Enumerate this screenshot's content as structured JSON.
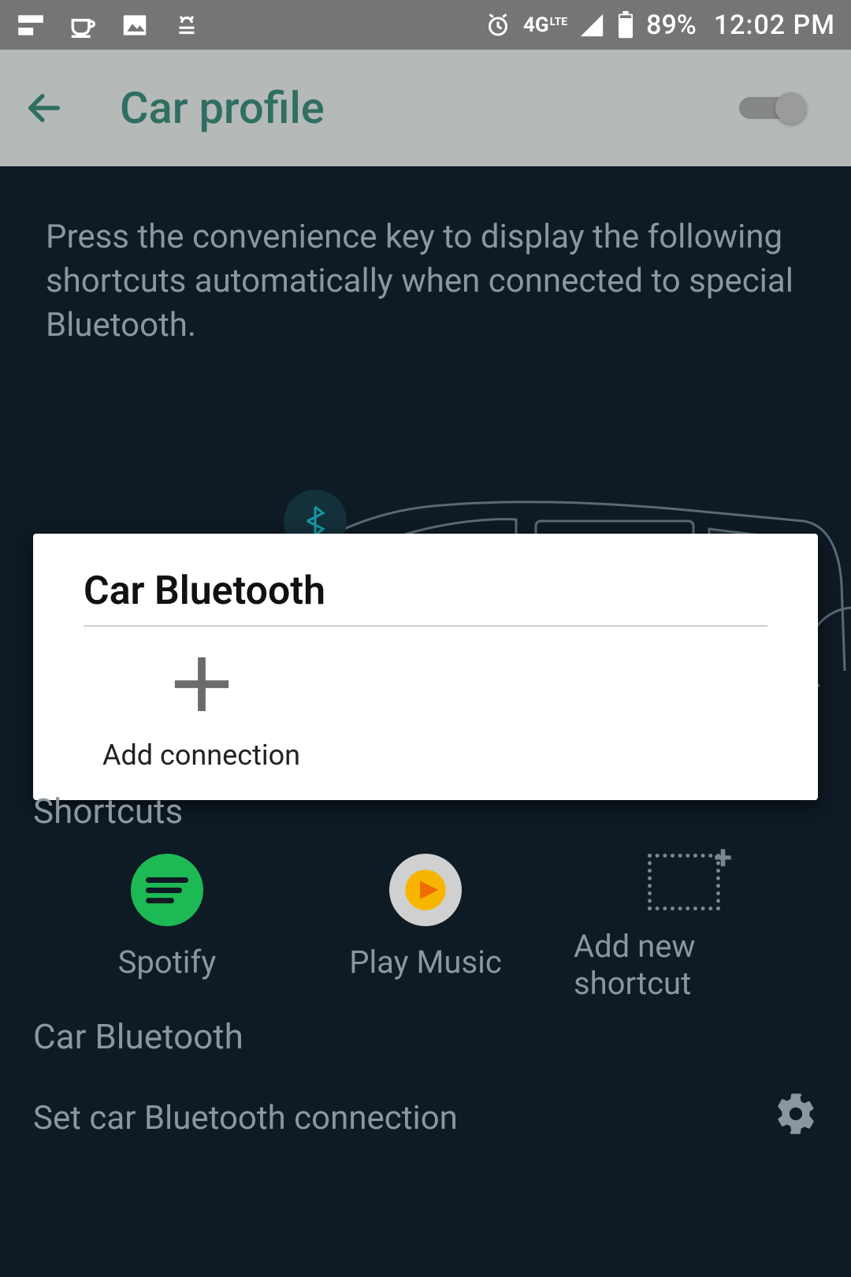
{
  "status_bar": {
    "battery_pct": "89%",
    "time": "12:02 PM",
    "network_label": "4G",
    "lte_sub": "LTE"
  },
  "app_bar": {
    "title": "Car profile"
  },
  "description": "Press the convenience key to display the following shortcuts automatically when connected to special Bluetooth.",
  "card": {
    "title": "Car Bluetooth",
    "add_label": "Add connection"
  },
  "shortcuts": {
    "heading": "Shortcuts",
    "items": [
      {
        "label": "Spotify"
      },
      {
        "label": "Play Music"
      },
      {
        "label": "Add new shortcut"
      }
    ]
  },
  "bt_section": {
    "heading": "Car Bluetooth",
    "row_label": "Set car Bluetooth connection"
  }
}
